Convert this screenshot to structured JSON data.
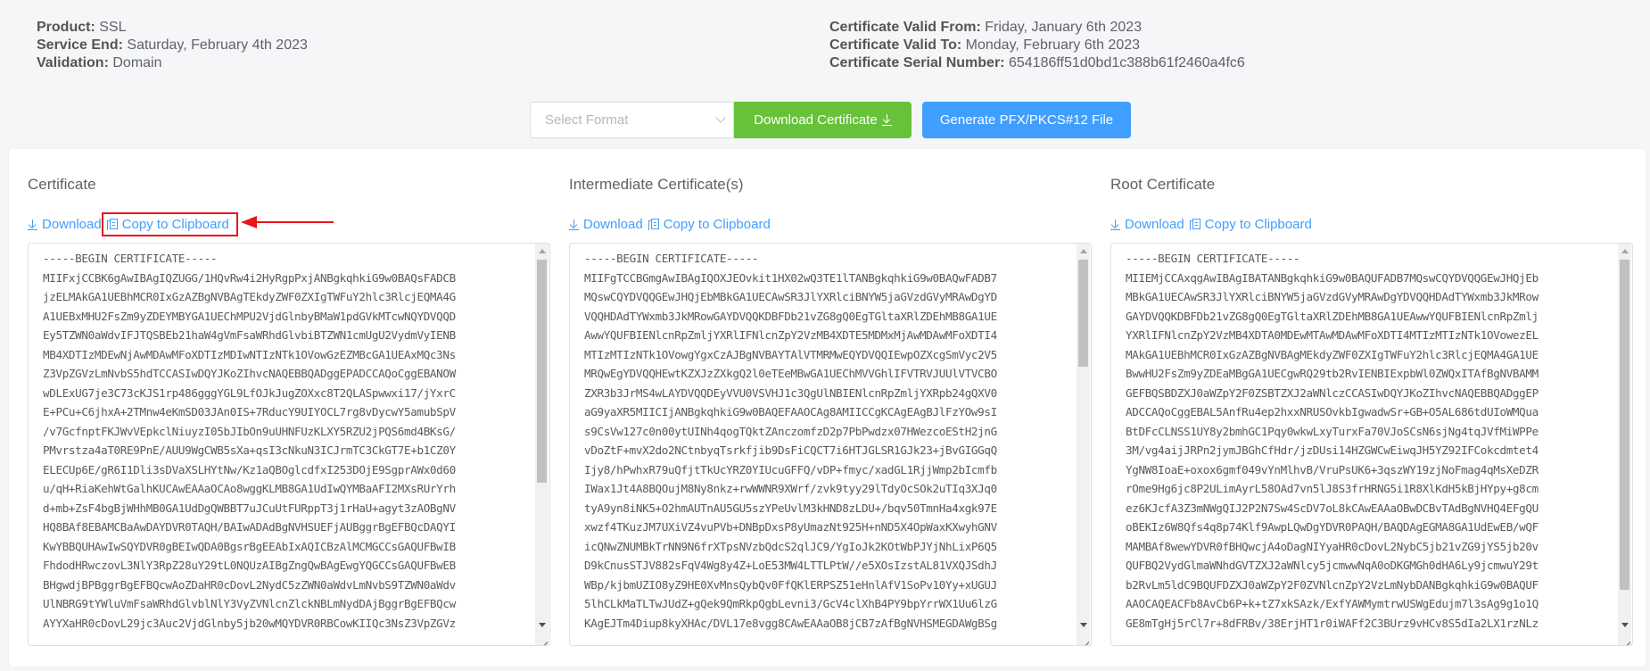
{
  "info_left": [
    {
      "label": "Product:",
      "value": "SSL"
    },
    {
      "label": "Service End:",
      "value": "Saturday, February 4th 2023"
    },
    {
      "label": "Validation:",
      "value": "Domain"
    }
  ],
  "info_right": [
    {
      "label": "Certificate Valid From:",
      "value": "Friday, January 6th 2023"
    },
    {
      "label": "Certificate Valid To:",
      "value": "Monday, February 6th 2023"
    },
    {
      "label": "Certificate Serial Number:",
      "value": "654186ff51d0bd1c388b61f2460a4fc6"
    }
  ],
  "actions": {
    "format_placeholder": "Select Format",
    "download_certificate": "Download Certificate",
    "generate_pfx": "Generate PFX/PKCS#12 File"
  },
  "colors": {
    "accent_blue": "#409eff",
    "accent_green": "#67c23a",
    "annotation_red": "#e8141b"
  },
  "columns": [
    {
      "title": "Certificate",
      "download_label": "Download",
      "copy_label": "Copy to Clipboard",
      "copy_highlighted": true,
      "scroll_position": 0.0,
      "lines": [
        "-----BEGIN CERTIFICATE-----",
        "MIIFxjCCBK6gAwIBAgIQZUGG/1HQvRw4i2HyRgpPxjANBgkqhkiG9w0BAQsFADCB",
        "jzELMAkGA1UEBhMCR0IxGzAZBgNVBAgTEkdyZWF0ZXIgTWFuY2hlc3RlcjEQMA4G",
        "A1UEBxMHU2FsZm9yZDEYMBYGA1UEChMPU2VjdGlnbyBMaW1pdGVkMTcwNQYDVQQD",
        "Ey5TZWN0aWdvIFJTQSBEb21haW4gVmFsaWRhdGlvbiBTZWN1cmUgU2VydmVyIENB",
        "MB4XDTIzMDEwNjAwMDAwMFoXDTIzMDIwNTIzNTk1OVowGzEZMBcGA1UEAxMQc3Ns",
        "Z3VpZGVzLmNvbS5hdTCCASIwDQYJKoZIhvcNAQEBBQADggEPADCCAQoCggEBANOW",
        "wDLExUG7je3C73cKJS1rp486gggYGL9LfOJkJugZOXxc8T2QLASpwwxi17/jYxrC",
        "E+PCu+C6jhxA+2TMnw4eKmSD03JAn0IS+7RducY9UIYOCL7rg8vDycwY5amubSpV",
        "/v7GcfnptFKJWvVEpkclNiuyzI05bJIbOn9uUHNFUzKLXY5RZU2jPQS6md4BKsG/",
        "PMvrstza4aT0RE9PnE/AUU9WgCWB5sXa+qsI3cNkuN3ICJrmTC3CkGT7E+b1CZ0Y",
        "ELECUp6E/gR6I1Dli3sDVaXSLHYtNw/Kz1aQBOglcdfxI253DOjE9SgprAWx0d60",
        "u/qH+RiaKehWtGalhKUCAwEAAaOCAo8wggKLMB8GA1UdIwQYMBaAFI2MXsRUrYrh",
        "d+mb+ZsF4bgBjWHhMB0GA1UdDgQWBBT7uJCuUtFURppT3j1rHaU+agyt3zAOBgNV",
        "HQ8BAf8EBAMCBaAwDAYDVR0TAQH/BAIwADAdBgNVHSUEFjAUBggrBgEFBQcDAQYI",
        "KwYBBQUHAwIwSQYDVR0gBEIwQDA0BgsrBgEEAbIxAQICBzAlMCMGCCsGAQUFBwIB",
        "FhdodHRwczovL3NlY3RpZ28uY29tL0NQUzAIBgZngQwBAgEwgYQGCCsGAQUFBwEB",
        "BHgwdjBPBggrBgEFBQcwAoZDaHR0cDovL2NydC5zZWN0aWdvLmNvbS9TZWN0aWdv",
        "UlNBRG9tYWluVmFsaWRhdGlvblNlY3VyZVNlcnZlckNBLmNydDAjBggrBgEFBQcw",
        "AYYXaHR0cDovL29jc3Auc2VjdGlnby5jb20wMQYDVR0RBCowKIIQc3NsZ3VpZGVz"
      ]
    },
    {
      "title": "Intermediate Certificate(s)",
      "download_label": "Download",
      "copy_label": "Copy to Clipboard",
      "copy_highlighted": false,
      "scroll_position": 0.0,
      "lines": [
        "-----BEGIN CERTIFICATE-----",
        "MIIFgTCCBGmgAwIBAgIQOXJEOvkit1HX02wQ3TE1lTANBgkqhkiG9w0BAQwFADB7",
        "MQswCQYDVQQGEwJHQjEbMBkGA1UECAwSR3JlYXRlciBNYW5jaGVzdGVyMRAwDgYD",
        "VQQHDAdTYWxmb3JkMRowGAYDVQQKDBFDb21vZG8gQ0EgTGltaXRlZDEhMB8GA1UE",
        "AwwYQUFBIENlcnRpZmljYXRlIFNlcnZpY2VzMB4XDTE5MDMxMjAwMDAwMFoXDTI4",
        "MTIzMTIzNTk1OVowgYgxCzAJBgNVBAYTAlVTMRMwEQYDVQQIEwpOZXcgSmVyc2V5",
        "MRQwEgYDVQQHEwtKZXJzZXkgQ2l0eTEeMBwGA1UEChMVVGhlIFVTRVJUUlVTVCBO",
        "ZXR3b3JrMS4wLAYDVQQDEyVVU0VSVHJ1c3QgUlNBIENlcnRpZmljYXRpb24gQXV0",
        "aG9yaXR5MIICIjANBgkqhkiG9w0BAQEFAAOCAg8AMIICCgKCAgEAgBJlFzYOw9sI",
        "s9CsVw127c0n00ytUINh4qogTQktZAnczomfzD2p7PbPwdzx07HWezcoEStH2jnG",
        "vDoZtF+mvX2do2NCtnbyqTsrkfjib9DsFiCQCT7i6HTJGLSR1GJk23+jBvGIGGqQ",
        "Ijy8/hPwhxR79uQfjtTkUcYRZ0YIUcuGFFQ/vDP+fmyc/xadGL1RjjWmp2bIcmfb",
        "IWax1Jt4A8BQOujM8Ny8nkz+rwWWNR9XWrf/zvk9tyy29lTdyOcSOk2uTIq3XJq0",
        "tyA9yn8iNK5+O2hmAUTnAU5GU5szYPeUvlM3kHND8zLDU+/bqv50TmnHa4xgk97E",
        "xwzf4TKuzJM7UXiVZ4vuPVb+DNBpDxsP8yUmazNt925H+nND5X4OpWaxKXwyhGNV",
        "icQNwZNUMBkTrNN9N6frXTpsNVzbQdcS2qlJC9/YgIoJk2KOtWbPJYjNhLixP6Q5",
        "D9kCnusSTJV882sFqV4Wg8y4Z+LoE53MW4LTTLPtW//e5XOsIzstAL81VXQJSdhJ",
        "WBp/kjbmUZIO8yZ9HE0XvMnsQybQv0FfQKlERPSZ51eHnlAfV1SoPv10Yy+xUGUJ",
        "5lhCLkMaTLTwJUdZ+gQek9QmRkpQgbLevni3/GcV4clXhB4PY9bpYrrWX1Uu6lzG",
        "KAgEJTm4Diup8kyXHAc/DVL17e8vgg8CAwEAAaOB8jCB7zAfBgNVHSMEGDAWgBSg"
      ]
    },
    {
      "title": "Root Certificate",
      "download_label": "Download",
      "copy_label": "Copy to Clipboard",
      "copy_highlighted": false,
      "scroll_position": 0.0,
      "lines": [
        "-----BEGIN CERTIFICATE-----",
        "MIIEMjCCAxqgAwIBAgIBATANBgkqhkiG9w0BAQUFADB7MQswCQYDVQQGEwJHQjEb",
        "MBkGA1UECAwSR3JlYXRlciBNYW5jaGVzdGVyMRAwDgYDVQQHDAdTYWxmb3JkMRow",
        "GAYDVQQKDBFDb21vZG8gQ0EgTGltaXRlZDEhMB8GA1UEAwwYQUFBIENlcnRpZmlj",
        "YXRlIFNlcnZpY2VzMB4XDTA0MDEwMTAwMDAwMFoXDTI4MTIzMTIzNTk1OVowezEL",
        "MAkGA1UEBhMCR0IxGzAZBgNVBAgMEkdyZWF0ZXIgTWFuY2hlc3RlcjEQMA4GA1UE",
        "BwwHU2FsZm9yZDEaMBgGA1UECgwRQ29tb2RvIENBIExpbWl0ZWQxITAfBgNVBAMM",
        "GEFBQSBDZXJ0aWZpY2F0ZSBTZXJ2aWNlczCCASIwDQYJKoZIhvcNAQEBBQADggEP",
        "ADCCAQoCggEBAL5AnfRu4ep2hxxNRUSOvkbIgwadwSr+GB+O5AL686tdUIoWMQua",
        "BtDFcCLNSS1UY8y2bmhGC1Pqy0wkwLxyTurxFa70VJoSCsN6sjNg4tqJVfMiWPPe",
        "3M/vg4aijJRPn2jymJBGhCfHdr/jzDUsi14HZGWCwEiwqJH5YZ92IFCokcdmtet4",
        "YgNW8IoaE+oxox6gmf049vYnMlhvB/VruPsUK6+3qszWY19zjNoFmag4qMsXeDZR",
        "rOme9Hg6jc8P2ULimAyrL58OAd7vn5lJ8S3frHRNG5i1R8XlKdH5kBjHYpy+g8cm",
        "ez6KJcfA3Z3mNWgQIJ2P2N7Sw4ScDV7oL8kCAwEAAaOBwDCBvTAdBgNVHQ4EFgQU",
        "oBEKIz6W8Qfs4q8p74Klf9AwpLQwDgYDVR0PAQH/BAQDAgEGMA8GA1UdEwEB/wQF",
        "MAMBAf8wewYDVR0fBHQwcjA4oDagNIYyaHR0cDovL2NybC5jb21vZG9jYS5jb20v",
        "QUFBQ2VydGlmaWNhdGVTZXJ2aWNlcy5jcmwwNqA0oDKGMGh0dHA6Ly9jcmwuY29t",
        "b2RvLm5ldC9BQUFDZXJ0aWZpY2F0ZVNlcnZpY2VzLmNybDANBgkqhkiG9w0BAQUF",
        "AAOCAQEACFb8AvCb6P+k+tZ7xkSAzk/ExfYAWMymtrwUSWgEdujm7l3sAg9g1o1Q",
        "GE8mTgHj5rCl7r+8dFRBv/38ErjHT1r0iWAFf2C3BUrz9vHCv8S5dIa2LX1rzNLz"
      ]
    }
  ]
}
